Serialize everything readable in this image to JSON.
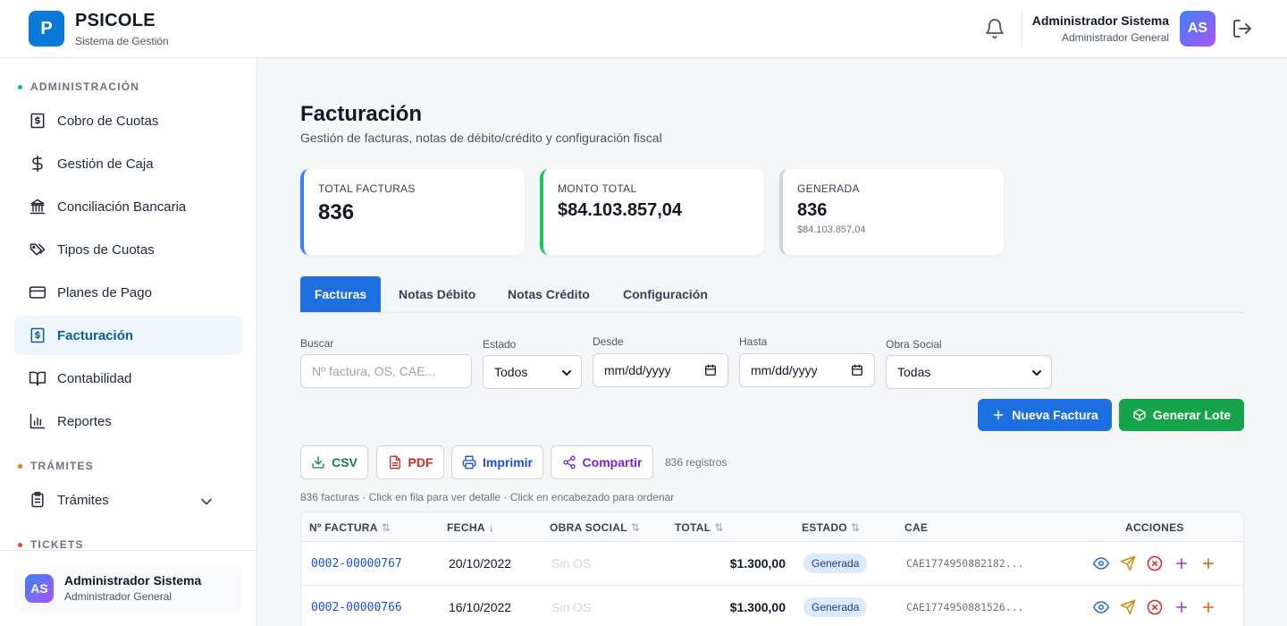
{
  "header": {
    "logo_letter": "P",
    "app_name": "PSICOLE",
    "app_subtitle": "Sistema de Gestión",
    "user_name": "Administrador Sistema",
    "user_role": "Administrador General",
    "user_initials": "AS"
  },
  "sidebar": {
    "sections": {
      "administracion": "ADMINISTRACIÓN",
      "tramites": "TRÁMITES",
      "tickets": "TICKETS"
    },
    "items": [
      {
        "label": "Cobro de Cuotas",
        "icon": "receipt-dollar-icon"
      },
      {
        "label": "Gestión de Caja",
        "icon": "dollar-icon"
      },
      {
        "label": "Conciliación Bancaria",
        "icon": "bank-icon"
      },
      {
        "label": "Tipos de Cuotas",
        "icon": "tags-icon"
      },
      {
        "label": "Planes de Pago",
        "icon": "credit-card-icon"
      },
      {
        "label": "Facturación",
        "icon": "receipt-dollar-icon",
        "active": true
      },
      {
        "label": "Contabilidad",
        "icon": "book-open-icon"
      },
      {
        "label": "Reportes",
        "icon": "bar-chart-icon"
      }
    ],
    "tramites_item": "Trámites",
    "footer": {
      "user_name": "Administrador Sistema",
      "user_role": "Administrador General",
      "user_initials": "AS"
    }
  },
  "page": {
    "title": "Facturación",
    "subtitle": "Gestión de facturas, notas de débito/crédito y configuración fiscal"
  },
  "cards": [
    {
      "label": "TOTAL FACTURAS",
      "value": "836",
      "accent": "#3b82f6"
    },
    {
      "label": "MONTO TOTAL",
      "value": "$84.103.857,04",
      "accent": "#22c55e"
    },
    {
      "label": "GENERADA",
      "value": "836",
      "extra": "$84.103.857,04",
      "accent": "#d1d5db"
    }
  ],
  "tabs": [
    "Facturas",
    "Notas Débito",
    "Notas Crédito",
    "Configuración"
  ],
  "filters": {
    "search_label": "Buscar",
    "search_placeholder": "Nº factura, OS, CAE...",
    "estado_label": "Estado",
    "estado_value": "Todos",
    "desde_label": "Desde",
    "desde_value": "mm/dd/yyyy",
    "hasta_label": "Hasta",
    "hasta_value": "mm/dd/yyyy",
    "obra_label": "Obra Social",
    "obra_value": "Todas"
  },
  "actions": {
    "nueva_factura": "Nueva Factura",
    "generar_lote": "Generar Lote",
    "csv": "CSV",
    "pdf": "PDF",
    "imprimir": "Imprimir",
    "compartir": "Compartir",
    "registros": "836 registros"
  },
  "hint": "836 facturas · Click en fila para ver detalle · Click en encabezado para ordenar",
  "table": {
    "columns": {
      "numero": "Nº FACTURA",
      "fecha": "FECHA",
      "obra": "OBRA SOCIAL",
      "total": "TOTAL",
      "estado": "ESTADO",
      "cae": "CAE",
      "acciones": "ACCIONES"
    },
    "rows": [
      {
        "numero": "0002-00000767",
        "fecha": "20/10/2022",
        "obra": "Sin OS",
        "total": "$1.300,00",
        "estado": "Generada",
        "cae": "CAE1774950882182..."
      },
      {
        "numero": "0002-00000766",
        "fecha": "16/10/2022",
        "obra": "Sin OS",
        "total": "$1.300,00",
        "estado": "Generada",
        "cae": "CAE1774950881526..."
      }
    ]
  },
  "colors": {
    "primary": "#1d6fe0",
    "success": "#16a34a",
    "brand": "#0a78d6"
  }
}
